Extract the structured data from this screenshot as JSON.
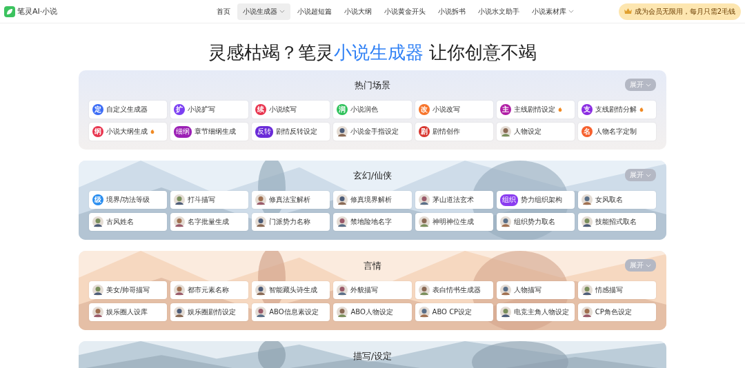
{
  "header": {
    "logo": "笔灵AI·小说",
    "nav": [
      {
        "label": "首页",
        "selected": false,
        "dropdown": false
      },
      {
        "label": "小说生成器",
        "selected": true,
        "dropdown": true
      },
      {
        "label": "小说超短篇",
        "selected": false,
        "dropdown": false
      },
      {
        "label": "小说大纲",
        "selected": false,
        "dropdown": false
      },
      {
        "label": "小说黄金开头",
        "selected": false,
        "dropdown": false
      },
      {
        "label": "小说拆书",
        "selected": false,
        "dropdown": false
      },
      {
        "label": "小说水文助手",
        "selected": false,
        "dropdown": false
      },
      {
        "label": "小说素材库",
        "selected": false,
        "dropdown": true
      }
    ],
    "promo": "成为会员无限用，每月只需2毛钱"
  },
  "headline": {
    "before": "灵感枯竭？笔灵",
    "highlight": "小说生成器",
    "after": " 让你创意不竭"
  },
  "sections": [
    {
      "title": "热门场景",
      "kind": "plain",
      "expand": "展开",
      "items": [
        {
          "label": "自定义生成器",
          "kind": "glyph",
          "glyph": "定",
          "color": "#3b6cf6",
          "hot": false
        },
        {
          "label": "小说扩写",
          "kind": "glyph",
          "glyph": "扩",
          "color": "#7b3ff2",
          "hot": false
        },
        {
          "label": "小说续写",
          "kind": "glyph",
          "glyph": "续",
          "color": "#e8344e",
          "hot": false
        },
        {
          "label": "小说润色",
          "kind": "glyph",
          "glyph": "润",
          "color": "#2fc25b",
          "hot": false
        },
        {
          "label": "小说改写",
          "kind": "glyph",
          "glyph": "改",
          "color": "#f7742a",
          "hot": false
        },
        {
          "label": "主线剧情设定",
          "kind": "glyph",
          "glyph": "主",
          "color": "#b01ea5",
          "hot": true
        },
        {
          "label": "支线剧情分解",
          "kind": "glyph",
          "glyph": "支",
          "color": "#8a2be2",
          "hot": true
        },
        {
          "label": "小说大纲生成",
          "kind": "glyph",
          "glyph": "纲",
          "color": "#e8344e",
          "hot": true
        },
        {
          "label": "章节细纲生成",
          "kind": "glyph",
          "glyph": "细纲",
          "color": "#9b1fb5",
          "hot": false
        },
        {
          "label": "剧情反转设定",
          "kind": "glyph",
          "glyph": "反转",
          "color": "#6a2bd8",
          "hot": false
        },
        {
          "label": "小说金手指设定",
          "kind": "picture",
          "hot": false
        },
        {
          "label": "剧情创作",
          "kind": "glyph",
          "glyph": "剧",
          "color": "#d8362f",
          "hot": false
        },
        {
          "label": "人物设定",
          "kind": "picture",
          "hot": false
        },
        {
          "label": "人物名字定制",
          "kind": "glyph",
          "glyph": "名",
          "color": "#f6602d",
          "hot": false
        }
      ]
    },
    {
      "title": "玄幻/仙侠",
      "kind": "picture",
      "expand": "展开",
      "items": [
        {
          "label": "境界/功法等级",
          "kind": "glyph",
          "glyph": "级",
          "color": "#2a8ef0",
          "hot": false
        },
        {
          "label": "打斗描写",
          "kind": "picture",
          "hot": false
        },
        {
          "label": "修真法宝解析",
          "kind": "picture",
          "hot": false
        },
        {
          "label": "修真境界解析",
          "kind": "picture",
          "hot": false
        },
        {
          "label": "茅山道法玄术",
          "kind": "picture",
          "hot": false
        },
        {
          "label": "势力组织架构",
          "kind": "glyph",
          "glyph": "组织",
          "color": "#8a3cf0",
          "hot": false
        },
        {
          "label": "女风取名",
          "kind": "picture",
          "hot": false
        },
        {
          "label": "古风姓名",
          "kind": "picture",
          "hot": false
        },
        {
          "label": "名字批量生成",
          "kind": "picture",
          "hot": false
        },
        {
          "label": "门派势力名称",
          "kind": "picture",
          "hot": false
        },
        {
          "label": "禁地险地名字",
          "kind": "picture",
          "hot": false
        },
        {
          "label": "神明神位生成",
          "kind": "picture",
          "hot": false
        },
        {
          "label": "组织势力取名",
          "kind": "picture",
          "hot": false
        },
        {
          "label": "技能招式取名",
          "kind": "picture",
          "hot": false
        }
      ]
    },
    {
      "title": "言情",
      "kind": "picture",
      "expand": "展开",
      "items": [
        {
          "label": "美女/帅哥描写",
          "kind": "picture",
          "hot": false
        },
        {
          "label": "都市元素名称",
          "kind": "picture",
          "hot": false
        },
        {
          "label": "智能藏头诗生成",
          "kind": "picture",
          "hot": false
        },
        {
          "label": "外貌描写",
          "kind": "picture",
          "hot": false
        },
        {
          "label": "表白情书生成器",
          "kind": "picture",
          "hot": false
        },
        {
          "label": "人物描写",
          "kind": "picture",
          "hot": false
        },
        {
          "label": "情感描写",
          "kind": "picture",
          "hot": false
        },
        {
          "label": "娱乐圈人设库",
          "kind": "picture",
          "hot": false
        },
        {
          "label": "娱乐圈剧情设定",
          "kind": "picture",
          "hot": false
        },
        {
          "label": "ABO信息素设定",
          "kind": "picture",
          "hot": false
        },
        {
          "label": "ABO人物设定",
          "kind": "picture",
          "hot": false
        },
        {
          "label": "ABO CP设定",
          "kind": "picture",
          "hot": false
        },
        {
          "label": "电竞主角人物设定",
          "kind": "picture",
          "hot": false
        },
        {
          "label": "CP角色设定",
          "kind": "picture",
          "hot": false
        }
      ]
    },
    {
      "title": "描写/设定",
      "kind": "picture"
    }
  ]
}
